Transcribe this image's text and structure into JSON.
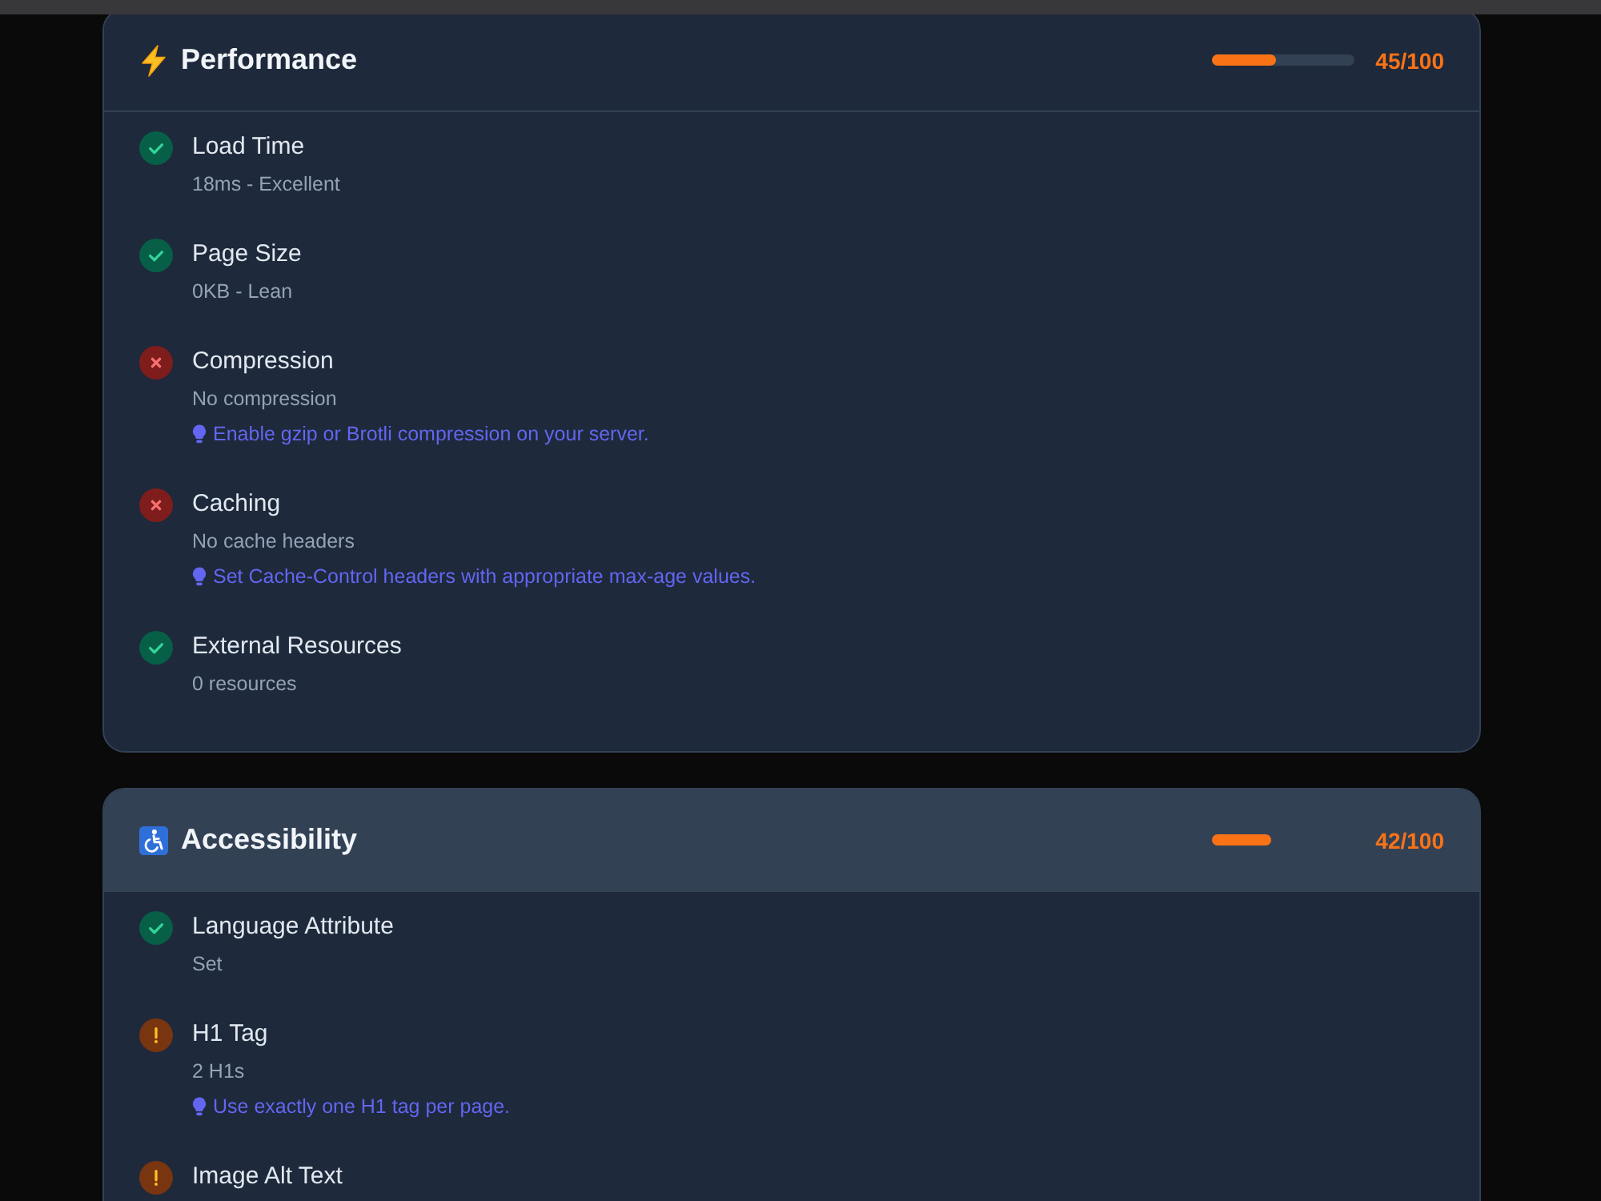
{
  "sections": [
    {
      "kind": "performance",
      "title": "Performance",
      "highlighted": false,
      "level": 0.45,
      "score": "45/100",
      "checks": [
        {
          "kind": "pass",
          "name": "Load Time",
          "detail": "18ms - Excellent"
        },
        {
          "kind": "pass",
          "name": "Page Size",
          "detail": "0KB - Lean"
        },
        {
          "kind": "fail",
          "name": "Compression",
          "detail": "No compression",
          "tip": "Enable gzip or Brotli compression on your server."
        },
        {
          "kind": "fail",
          "name": "Caching",
          "detail": "No cache headers",
          "tip": "Set Cache-Control headers with appropriate max-age values."
        },
        {
          "kind": "pass",
          "name": "External Resources",
          "detail": "0 resources"
        }
      ]
    },
    {
      "kind": "accessibility",
      "title": "Accessibility",
      "highlighted": true,
      "level": 0.42,
      "score": "42/100",
      "checks": [
        {
          "kind": "pass",
          "name": "Language Attribute",
          "detail": "Set"
        },
        {
          "kind": "warn",
          "name": "H1 Tag",
          "detail": "2 H1s",
          "tip": "Use exactly one H1 tag per page."
        },
        {
          "kind": "warn",
          "name": "Image Alt Text"
        }
      ]
    }
  ]
}
